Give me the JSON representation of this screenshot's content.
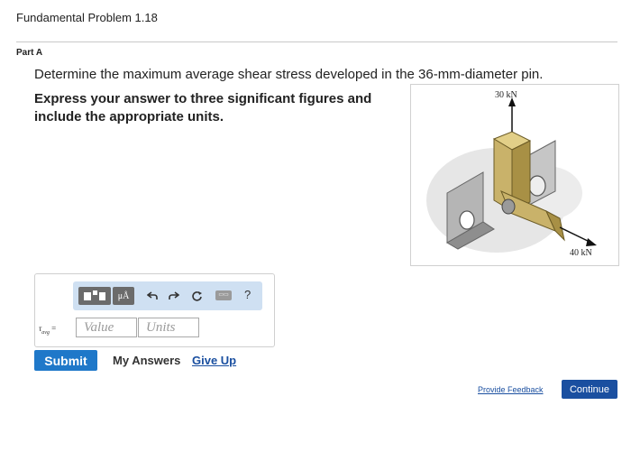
{
  "header": {
    "title": "Fundamental Problem 1.18"
  },
  "part": {
    "label": "Part A"
  },
  "question": {
    "prompt": "Determine the maximum average shear stress developed in the 36-mm-diameter pin.",
    "instruction": "Express your answer to three significant figures and include the appropriate units."
  },
  "figure": {
    "load_top": "30 kN",
    "load_right": "40 kN"
  },
  "answer": {
    "variable": "τ",
    "subscript": "avg",
    "equals": "=",
    "value_placeholder": "Value",
    "units_placeholder": "Units"
  },
  "toolbar": {
    "mu_label": "μÅ",
    "undo_icon": "undo-icon",
    "redo_icon": "redo-icon",
    "reset_icon": "reset-icon",
    "keyboard_icon": "keyboard-icon",
    "help_label": "?"
  },
  "actions": {
    "submit_label": "Submit",
    "my_answers_label": "My Answers",
    "give_up_label": "Give Up",
    "feedback_label": "Provide Feedback",
    "continue_label": "Continue"
  },
  "colors": {
    "primary": "#1f78c9",
    "link": "#1a4fa0",
    "toolbar_bg": "#cfe0f2",
    "block": "#c9b26a"
  }
}
